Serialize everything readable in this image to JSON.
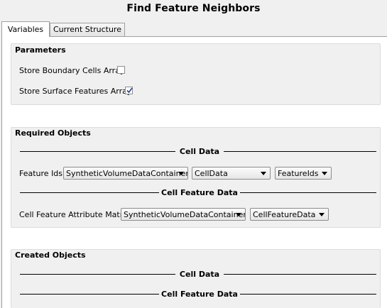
{
  "window_title": "Find Feature Neighbors",
  "tabs": [
    {
      "label": "Variables",
      "active": true
    },
    {
      "label": "Current Structure",
      "active": false
    }
  ],
  "parameters": {
    "title": "Parameters",
    "items": [
      {
        "label": "Store Boundary Cells Array",
        "checked": false
      },
      {
        "label": "Store Surface Features Array",
        "checked": true
      }
    ]
  },
  "required_objects": {
    "title": "Required Objects",
    "cell_data_heading": "Cell Data",
    "feature_ids": {
      "label": "Feature Ids",
      "data_container": "SyntheticVolumeDataContainer",
      "attribute_matrix": "CellData",
      "array": "FeatureIds"
    },
    "cell_feature_data_heading": "Cell Feature Data",
    "cell_feature_attribute_matrix": {
      "label": "Cell Feature Attribute Matrix",
      "data_container": "SyntheticVolumeDataContainer",
      "attribute_matrix": "CellFeatureData"
    }
  },
  "created_objects": {
    "title": "Created Objects",
    "cell_data_heading": "Cell Data",
    "cell_feature_data_heading": "Cell Feature Data"
  }
}
